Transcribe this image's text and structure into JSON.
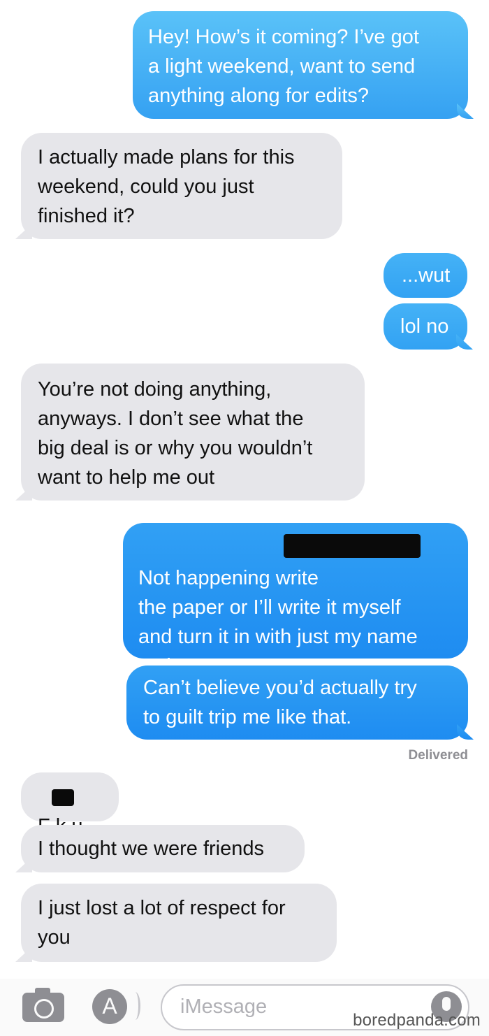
{
  "messages": [
    {
      "id": "m1",
      "direction": "sent",
      "text": "Hey! How’s it coming? I’ve got\na light weekend, want to send\nanything along for edits?"
    },
    {
      "id": "m2",
      "direction": "received",
      "text": "I actually made plans for this\nweekend, could you just\nfinished it?"
    },
    {
      "id": "m3",
      "direction": "sent",
      "text": "...wut"
    },
    {
      "id": "m4",
      "direction": "sent",
      "text": "lol no"
    },
    {
      "id": "m5",
      "direction": "received",
      "text": "You’re not doing anything,\nanyways. I don’t see what the\nbig deal is or why you wouldn’t\nwant to help me out"
    },
    {
      "id": "m6",
      "direction": "sent",
      "text": "Not happening                   write\nthe paper or I’ll write it myself\nand turn it in with just my name\non it. I mean, come on."
    },
    {
      "id": "m7",
      "direction": "sent",
      "text": "Can’t believe you’d actually try\nto guilt trip me like that."
    },
    {
      "id": "m8",
      "direction": "received",
      "text": "F       k u"
    },
    {
      "id": "m9",
      "direction": "received",
      "text": "I thought we were friends"
    },
    {
      "id": "m10",
      "direction": "received",
      "text": "I just lost a lot of respect for\nyou"
    }
  ],
  "status": {
    "delivered": "Delivered"
  },
  "composer": {
    "placeholder": "iMessage"
  },
  "icons": {
    "camera": "camera-icon",
    "apps": "app-store-icon",
    "mic": "microphone-icon"
  },
  "watermark": "boredpanda.com",
  "colors": {
    "sent_bubble": "#35a1f2",
    "received_bubble": "#e6e6ea",
    "sent_text": "#ffffff",
    "received_text": "#111111"
  }
}
